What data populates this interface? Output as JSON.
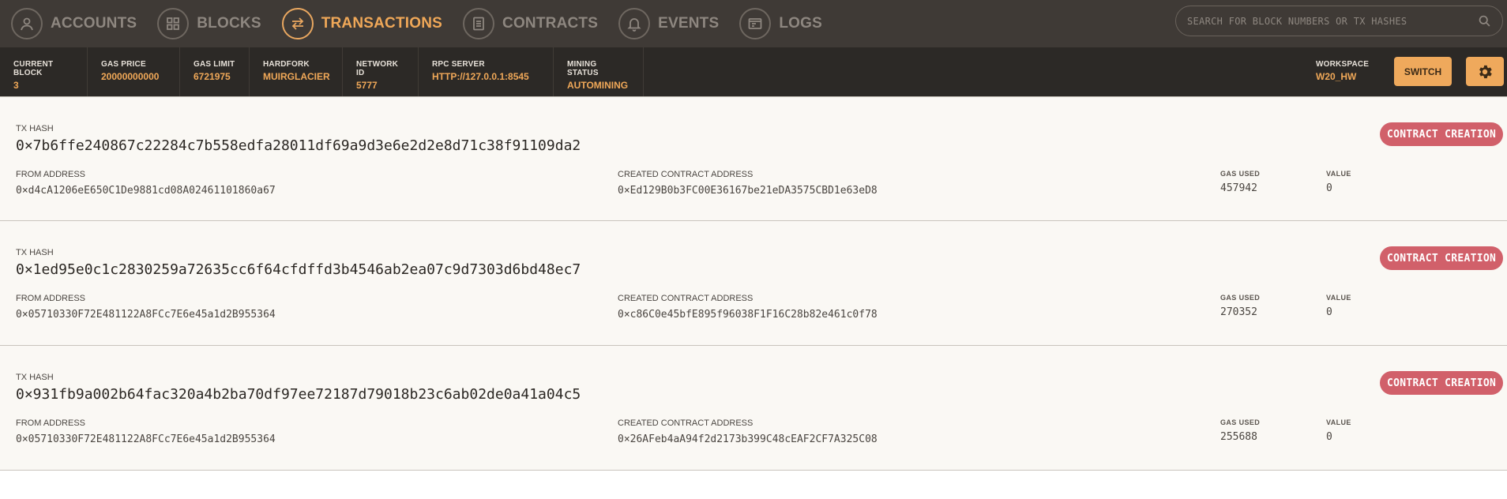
{
  "nav": {
    "items": [
      {
        "label": "ACCOUNTS",
        "icon": "user-icon",
        "active": false
      },
      {
        "label": "BLOCKS",
        "icon": "grid-icon",
        "active": false
      },
      {
        "label": "TRANSACTIONS",
        "icon": "swap-icon",
        "active": true
      },
      {
        "label": "CONTRACTS",
        "icon": "document-icon",
        "active": false
      },
      {
        "label": "EVENTS",
        "icon": "bell-icon",
        "active": false
      },
      {
        "label": "LOGS",
        "icon": "terminal-icon",
        "active": false
      }
    ],
    "search_placeholder": "SEARCH FOR BLOCK NUMBERS OR TX HASHES"
  },
  "status": {
    "current_block": {
      "label": "CURRENT BLOCK",
      "value": "3"
    },
    "gas_price": {
      "label": "GAS PRICE",
      "value": "20000000000"
    },
    "gas_limit": {
      "label": "GAS LIMIT",
      "value": "6721975"
    },
    "hardfork": {
      "label": "HARDFORK",
      "value": "MUIRGLACIER"
    },
    "network_id": {
      "label": "NETWORK ID",
      "value": "5777"
    },
    "rpc_server": {
      "label": "RPC SERVER",
      "value": "HTTP://127.0.0.1:8545"
    },
    "mining_status": {
      "label": "MINING STATUS",
      "value": "AUTOMINING"
    },
    "workspace": {
      "label": "WORKSPACE",
      "value": "W20_HW"
    },
    "switch_label": "SWITCH"
  },
  "labels": {
    "tx_hash": "TX HASH",
    "from_address": "FROM ADDRESS",
    "created_contract_address": "CREATED CONTRACT ADDRESS",
    "gas_used": "GAS USED",
    "value": "VALUE"
  },
  "transactions": [
    {
      "hash": "0×7b6ffe240867c22284c7b558edfa28011df69a9d3e6e2d2e8d71c38f91109da2",
      "from": "0×d4cA1206eE650C1De9881cd08A02461101860a67",
      "created_contract": "0×Ed129B0b3FC00E36167be21eDA3575CBD1e63eD8",
      "gas_used": "457942",
      "value": "0",
      "badge": "CONTRACT CREATION"
    },
    {
      "hash": "0×1ed95e0c1c2830259a72635cc6f64cfdffd3b4546ab2ea07c9d7303d6bd48ec7",
      "from": "0×05710330F72E481122A8FCc7E6e45a1d2B955364",
      "created_contract": "0×c86C0e45bfE895f96038F1F16C28b82e461c0f78",
      "gas_used": "270352",
      "value": "0",
      "badge": "CONTRACT CREATION"
    },
    {
      "hash": "0×931fb9a002b64fac320a4b2ba70df97ee72187d79018b23c6ab02de0a41a04c5",
      "from": "0×05710330F72E481122A8FCc7E6e45a1d2B955364",
      "created_contract": "0×26AFeb4aA94f2d2173b399C48cEAF2CF7A325C08",
      "gas_used": "255688",
      "value": "0",
      "badge": "CONTRACT CREATION"
    }
  ]
}
